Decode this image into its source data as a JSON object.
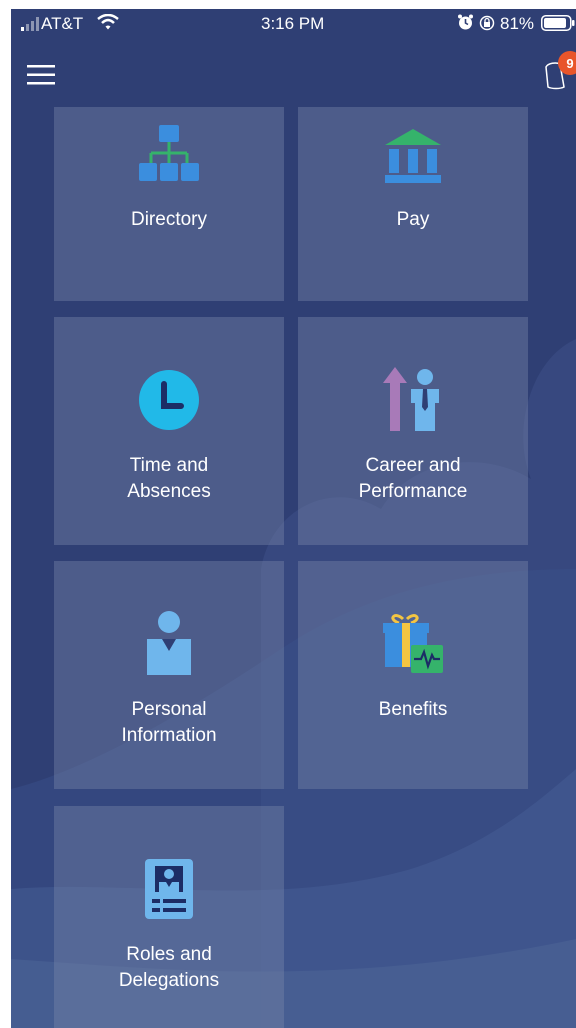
{
  "status_bar": {
    "carrier": "AT&T",
    "time": "3:16 PM",
    "battery_percent": "81%",
    "icons": [
      "signal-icon",
      "wifi-icon",
      "alarm-icon",
      "orientation-lock-icon",
      "battery-icon"
    ]
  },
  "header": {
    "menu_icon": "hamburger-menu-icon",
    "notifications_icon": "notification-bell-icon",
    "notification_count": "9"
  },
  "tiles": [
    {
      "label": "Directory",
      "icon": "directory-icon"
    },
    {
      "label": "Pay",
      "icon": "pay-bank-icon"
    },
    {
      "label_line1": "Time and",
      "label_line2": "Absences",
      "icon": "clock-icon"
    },
    {
      "label_line1": "Career and",
      "label_line2": "Performance",
      "icon": "career-growth-icon"
    },
    {
      "label_line1": "Personal",
      "label_line2": "Information",
      "icon": "person-icon"
    },
    {
      "label": "Benefits",
      "icon": "benefits-gift-icon"
    },
    {
      "label_line1": "Roles and",
      "label_line2": "Delegations",
      "icon": "id-badge-icon"
    }
  ],
  "colors": {
    "background": "#2f3f74",
    "tile": "#5a6a98",
    "badge": "#e8552a",
    "icon_blue": "#3b8ede",
    "icon_green": "#35b36b",
    "clock_cyan": "#21b9e8"
  }
}
